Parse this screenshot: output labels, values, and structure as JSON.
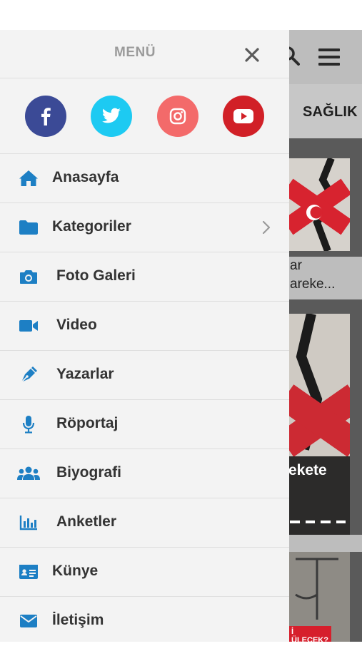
{
  "drawer": {
    "title": "MENÜ",
    "social": [
      {
        "name": "facebook",
        "icon": "facebook-icon",
        "color": "#3b4a96"
      },
      {
        "name": "twitter",
        "icon": "twitter-icon",
        "color": "#1dcaf2"
      },
      {
        "name": "instagram",
        "icon": "instagram-icon",
        "color": "#f36a6a"
      },
      {
        "name": "youtube",
        "icon": "youtube-icon",
        "color": "#d12027"
      }
    ],
    "items": [
      {
        "label": "Anasayfa",
        "icon": "home-icon"
      },
      {
        "label": "Kategoriler",
        "icon": "folder-icon",
        "has_submenu": true
      },
      {
        "label": "Foto Galeri",
        "icon": "camera-icon"
      },
      {
        "label": "Video",
        "icon": "video-camera-icon"
      },
      {
        "label": "Yazarlar",
        "icon": "pen-icon"
      },
      {
        "label": "Röportaj",
        "icon": "microphone-icon"
      },
      {
        "label": "Biyografi",
        "icon": "users-icon"
      },
      {
        "label": "Anketler",
        "icon": "bar-chart-icon"
      },
      {
        "label": "Künye",
        "icon": "id-card-icon"
      },
      {
        "label": "İletişim",
        "icon": "envelope-icon"
      }
    ]
  },
  "background": {
    "tab_label": "SAĞLIK",
    "card1_text_line1": "ar",
    "card1_text_line2": "areke...",
    "card2_text": "ekete",
    "card3_badge_line1": "İ",
    "card3_badge_line2": "ÜLECEK?"
  },
  "colors": {
    "accent_icon": "#1d7fc4",
    "drawer_bg": "#f3f3f3",
    "label": "#333333"
  }
}
